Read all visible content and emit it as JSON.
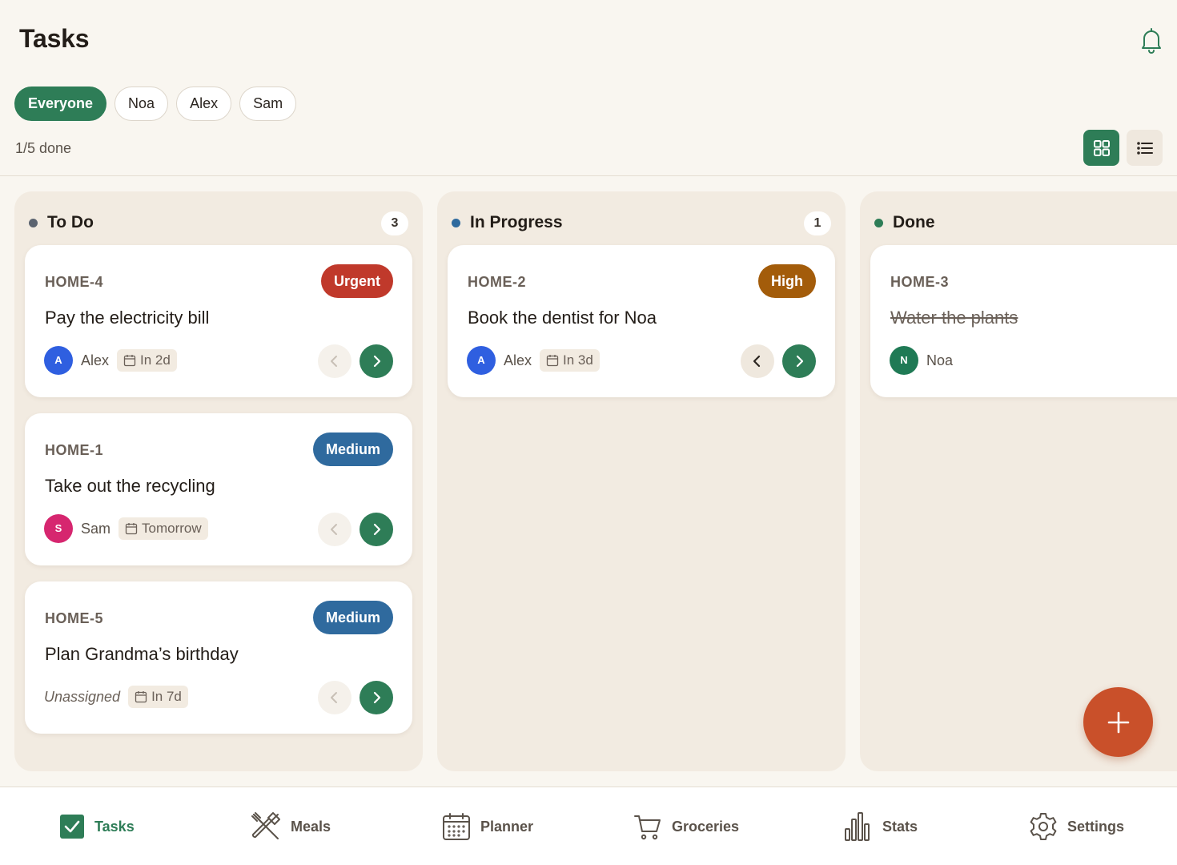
{
  "header": {
    "title": "Tasks",
    "progress": "1/5 done",
    "done_count": 1,
    "total_count": 5
  },
  "filters": [
    {
      "label": "Everyone",
      "active": true
    },
    {
      "label": "Noa",
      "active": false
    },
    {
      "label": "Alex",
      "active": false
    },
    {
      "label": "Sam",
      "active": false
    }
  ],
  "view": {
    "selected": "grid",
    "options": [
      "grid-icon",
      "list-icon"
    ]
  },
  "colors": {
    "accent": "#2e7d57",
    "urgent": "#c0392b",
    "high": "#a35c0a",
    "medium": "#2f6a9e",
    "fab": "#c9502a"
  },
  "columns": [
    {
      "title": "To Do",
      "dot": "#5c6470",
      "count": "3",
      "cards": [
        {
          "id": "HOME-4",
          "priority": "Urgent",
          "title": "Pay the electricity bill",
          "assignee": "Alex",
          "initial": "A",
          "avatar": "#2f5fe0",
          "due": "In 2d",
          "done": false
        },
        {
          "id": "HOME-1",
          "priority": "Medium",
          "title": "Take out the recycling",
          "assignee": "Sam",
          "initial": "S",
          "avatar": "#d6266f",
          "due": "Tomorrow",
          "done": false
        },
        {
          "id": "HOME-5",
          "priority": "Medium",
          "title": "Plan Grandma’s birthday",
          "assignee": "Unassigned",
          "initial": "",
          "avatar": "",
          "due": "In 7d",
          "done": false
        }
      ]
    },
    {
      "title": "In Progress",
      "dot": "#2f6a9e",
      "count": "1",
      "cards": [
        {
          "id": "HOME-2",
          "priority": "High",
          "title": "Book the dentist for Noa",
          "assignee": "Alex",
          "initial": "A",
          "avatar": "#2f5fe0",
          "due": "In 3d",
          "done": false
        }
      ]
    },
    {
      "title": "Done",
      "dot": "#2e7d57",
      "count": "",
      "cards": [
        {
          "id": "HOME-3",
          "priority": "",
          "title": "Water the plants",
          "assignee": "Noa",
          "initial": "N",
          "avatar": "#1f7a55",
          "due": "",
          "done": true
        }
      ]
    }
  ],
  "fab": {
    "icon": "plus-icon"
  },
  "tabbar": [
    {
      "label": "Tasks",
      "icon": "checkbox-icon",
      "active": true
    },
    {
      "label": "Meals",
      "icon": "utensils-icon",
      "active": false
    },
    {
      "label": "Planner",
      "icon": "calendar-icon",
      "active": false
    },
    {
      "label": "Groceries",
      "icon": "cart-icon",
      "active": false
    },
    {
      "label": "Stats",
      "icon": "bar-chart-icon",
      "active": false
    },
    {
      "label": "Settings",
      "icon": "gear-icon",
      "active": false
    }
  ]
}
